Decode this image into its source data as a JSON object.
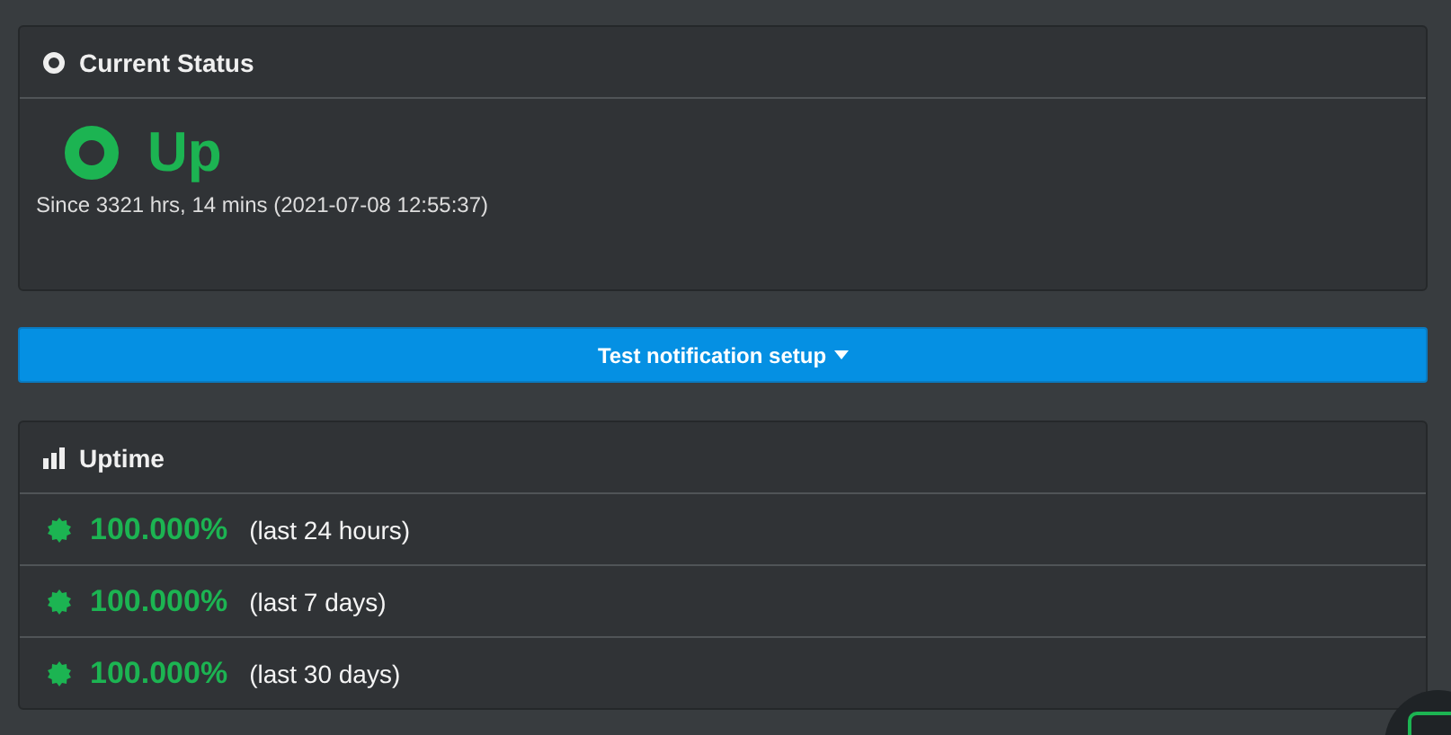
{
  "current_status": {
    "title": "Current Status",
    "color": "#1cb452",
    "label": "Up",
    "since": "Since 3321 hrs, 14 mins (2021-07-08 12:55:37)"
  },
  "test_button": {
    "label": "Test notification setup"
  },
  "uptime": {
    "title": "Uptime",
    "rows": [
      {
        "value": "100.000%",
        "period": "(last 24 hours)",
        "color": "#1cb452"
      },
      {
        "value": "100.000%",
        "period": "(last 7 days)",
        "color": "#1cb452"
      },
      {
        "value": "100.000%",
        "period": "(last 30 days)",
        "color": "#1cb452"
      }
    ]
  }
}
